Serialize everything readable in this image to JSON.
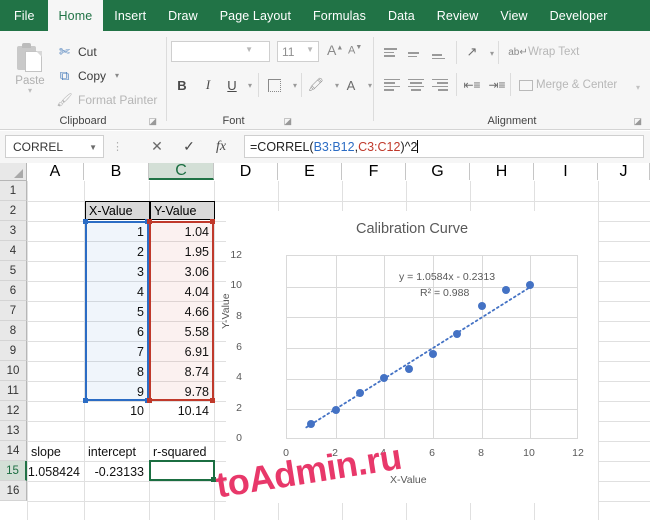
{
  "ribbon": {
    "tabs": [
      {
        "label": "File",
        "active": false
      },
      {
        "label": "Home",
        "active": true
      },
      {
        "label": "Insert",
        "active": false
      },
      {
        "label": "Draw",
        "active": false
      },
      {
        "label": "Page Layout",
        "active": false
      },
      {
        "label": "Formulas",
        "active": false
      },
      {
        "label": "Data",
        "active": false
      },
      {
        "label": "Review",
        "active": false
      },
      {
        "label": "View",
        "active": false
      },
      {
        "label": "Developer",
        "active": false
      }
    ],
    "groups": {
      "clipboard": {
        "label": "Clipboard",
        "paste_label": "Paste",
        "cut_label": "Cut",
        "copy_label": "Copy",
        "format_painter_label": "Format Painter",
        "cut_icon": "scissors-icon",
        "copy_icon": "copy-icon",
        "format_painter_icon": "paintbrush-icon",
        "paste_icon": "clipboard-icon"
      },
      "font": {
        "label": "Font",
        "font_name_value": "",
        "font_size_value": "11",
        "grow_font_label": "A",
        "shrink_font_label": "A",
        "bold_label": "B",
        "italic_label": "I",
        "underline_label": "U",
        "borders_icon": "borders-icon",
        "fill_icon": "fill-color-icon",
        "font_color_label": "A"
      },
      "alignment": {
        "label": "Alignment",
        "wrap_text_label": "Wrap Text",
        "merge_center_label": "Merge & Center",
        "orientation_icon": "text-orientation-icon",
        "wrap_icon": "wrap-text-icon",
        "merge_icon": "merge-cells-icon",
        "decrease_indent_icon": "decrease-indent-icon",
        "increase_indent_icon": "increase-indent-icon"
      }
    }
  },
  "formula_bar": {
    "name_box_value": "CORREL",
    "cancel_icon": "cancel-x-icon",
    "enter_icon": "confirm-check-icon",
    "function_icon": "insert-function-fx-icon",
    "formula_full": "=CORREL(B3:B12,C3:C12)^2",
    "formula_parts": {
      "p1": "=CORREL(",
      "ref1": "B3:B12",
      "comma": ",",
      "ref2": "C3:C12",
      "p2": ")^2"
    }
  },
  "sheet": {
    "column_headers": [
      "A",
      "B",
      "C",
      "D",
      "E",
      "F",
      "G",
      "H",
      "I",
      "J"
    ],
    "selected_column": "C",
    "row_headers": [
      "1",
      "2",
      "3",
      "4",
      "5",
      "6",
      "7",
      "8",
      "9",
      "10",
      "11",
      "12",
      "13",
      "14",
      "15",
      "16"
    ],
    "selected_row": "15",
    "headers": {
      "b2": "X-Value",
      "c2": "Y-Value"
    },
    "table": {
      "x_values": [
        "1",
        "2",
        "3",
        "4",
        "5",
        "6",
        "7",
        "8",
        "9",
        "10"
      ],
      "y_values": [
        "1.04",
        "1.95",
        "3.06",
        "4.04",
        "4.66",
        "5.58",
        "6.91",
        "8.74",
        "9.78",
        "10.14"
      ]
    },
    "stats": {
      "slope_label": "slope",
      "intercept_label": "intercept",
      "rsquared_label": "r-squared",
      "slope_value": "1.058424",
      "intercept_value": "-0.23133",
      "rsquared_value": ""
    }
  },
  "chart_data": {
    "type": "scatter",
    "title": "Calibration Curve",
    "xlabel": "X-Value",
    "ylabel": "Y-Value",
    "x": [
      1,
      2,
      3,
      4,
      5,
      6,
      7,
      8,
      9,
      10
    ],
    "y": [
      1.04,
      1.95,
      3.06,
      4.04,
      4.66,
      5.58,
      6.91,
      8.74,
      9.78,
      10.14
    ],
    "xlim": [
      0,
      12
    ],
    "ylim": [
      0,
      12
    ],
    "xticks": [
      "0",
      "2",
      "4",
      "6",
      "8",
      "10",
      "12"
    ],
    "yticks": [
      "0",
      "2",
      "4",
      "6",
      "8",
      "10",
      "12"
    ],
    "grid": true,
    "legend": "none",
    "series_color": "#4472C4",
    "trendline": {
      "type": "linear-dotted",
      "slope": 1.0584,
      "intercept": -0.2313,
      "equation_label": "y = 1.0584x - 0.2313",
      "r2_label": "R² = 0.988",
      "r2": 0.988
    }
  },
  "watermark": {
    "text": "toAdmin.ru",
    "color": "#e8386a"
  }
}
